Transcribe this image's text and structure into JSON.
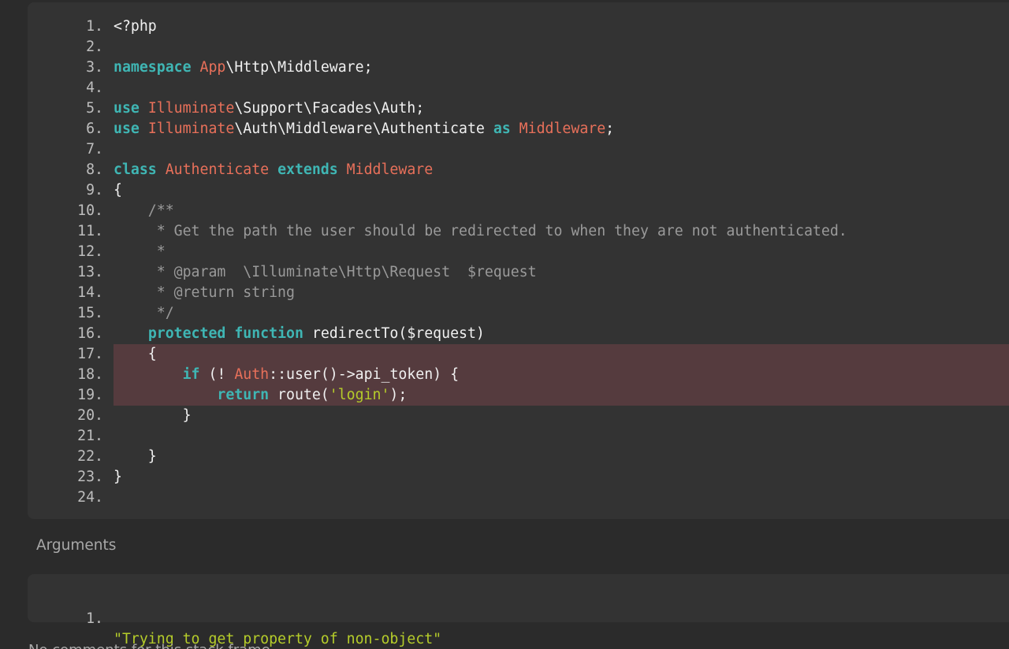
{
  "code": {
    "lines": [
      {
        "n": "1",
        "segments": [
          {
            "t": "<?php",
            "c": "plain"
          }
        ]
      },
      {
        "n": "2",
        "segments": []
      },
      {
        "n": "3",
        "segments": [
          {
            "t": "namespace",
            "c": "kw"
          },
          {
            "t": " ",
            "c": "plain"
          },
          {
            "t": "App",
            "c": "cls"
          },
          {
            "t": "\\Http\\Middleware;",
            "c": "plain"
          }
        ]
      },
      {
        "n": "4",
        "segments": []
      },
      {
        "n": "5",
        "segments": [
          {
            "t": "use",
            "c": "kw"
          },
          {
            "t": " ",
            "c": "plain"
          },
          {
            "t": "Illuminate",
            "c": "cls"
          },
          {
            "t": "\\Support\\Facades\\Auth;",
            "c": "plain"
          }
        ]
      },
      {
        "n": "6",
        "segments": [
          {
            "t": "use",
            "c": "kw"
          },
          {
            "t": " ",
            "c": "plain"
          },
          {
            "t": "Illuminate",
            "c": "cls"
          },
          {
            "t": "\\Auth\\Middleware\\Authenticate ",
            "c": "plain"
          },
          {
            "t": "as",
            "c": "kw"
          },
          {
            "t": " ",
            "c": "plain"
          },
          {
            "t": "Middleware",
            "c": "cls"
          },
          {
            "t": ";",
            "c": "plain"
          }
        ]
      },
      {
        "n": "7",
        "segments": []
      },
      {
        "n": "8",
        "segments": [
          {
            "t": "class",
            "c": "kw"
          },
          {
            "t": " ",
            "c": "plain"
          },
          {
            "t": "Authenticate",
            "c": "cls"
          },
          {
            "t": " ",
            "c": "plain"
          },
          {
            "t": "extends",
            "c": "kw"
          },
          {
            "t": " ",
            "c": "plain"
          },
          {
            "t": "Middleware",
            "c": "cls"
          }
        ]
      },
      {
        "n": "9",
        "segments": [
          {
            "t": "{",
            "c": "plain"
          }
        ]
      },
      {
        "n": "10",
        "segments": [
          {
            "t": "    /**",
            "c": "cm"
          }
        ]
      },
      {
        "n": "11",
        "segments": [
          {
            "t": "     * Get the path the user should be redirected to when they are not authenticated.",
            "c": "cm"
          }
        ]
      },
      {
        "n": "12",
        "segments": [
          {
            "t": "     *",
            "c": "cm"
          }
        ]
      },
      {
        "n": "13",
        "segments": [
          {
            "t": "     * @param  \\Illuminate\\Http\\Request  $request",
            "c": "cm"
          }
        ]
      },
      {
        "n": "14",
        "segments": [
          {
            "t": "     * @return string",
            "c": "cm"
          }
        ]
      },
      {
        "n": "15",
        "segments": [
          {
            "t": "     */",
            "c": "cm"
          }
        ]
      },
      {
        "n": "16",
        "segments": [
          {
            "t": "    ",
            "c": "plain"
          },
          {
            "t": "protected",
            "c": "kw"
          },
          {
            "t": " ",
            "c": "plain"
          },
          {
            "t": "function",
            "c": "kw"
          },
          {
            "t": " redirectTo($request)",
            "c": "plain"
          }
        ]
      },
      {
        "n": "17",
        "highlight": true,
        "segments": [
          {
            "t": "    {",
            "c": "plain"
          }
        ]
      },
      {
        "n": "18",
        "highlight": true,
        "segments": [
          {
            "t": "        ",
            "c": "plain"
          },
          {
            "t": "if",
            "c": "kw"
          },
          {
            "t": " (! ",
            "c": "plain"
          },
          {
            "t": "Auth",
            "c": "cls"
          },
          {
            "t": "::user()->api_token) {",
            "c": "plain"
          }
        ]
      },
      {
        "n": "19",
        "highlight": true,
        "segments": [
          {
            "t": "            ",
            "c": "plain"
          },
          {
            "t": "return",
            "c": "kw"
          },
          {
            "t": " route(",
            "c": "plain"
          },
          {
            "t": "'login'",
            "c": "str"
          },
          {
            "t": ");",
            "c": "plain"
          }
        ]
      },
      {
        "n": "20",
        "segments": [
          {
            "t": "        }",
            "c": "plain"
          }
        ]
      },
      {
        "n": "21",
        "segments": []
      },
      {
        "n": "22",
        "segments": [
          {
            "t": "    }",
            "c": "plain"
          }
        ]
      },
      {
        "n": "23",
        "segments": [
          {
            "t": "}",
            "c": "plain"
          }
        ]
      },
      {
        "n": "24",
        "segments": []
      }
    ]
  },
  "arguments": {
    "title": "Arguments",
    "items": [
      {
        "n": "1",
        "value": "\"Trying to get property of non-object\""
      }
    ]
  },
  "footer": {
    "note": "No comments for this stack frame."
  },
  "colors": {
    "keyword": "#3fb6b4",
    "class": "#e8705a",
    "string": "#b5cc2a",
    "comment": "#9a9a9a",
    "highlight": "#553b3e"
  }
}
